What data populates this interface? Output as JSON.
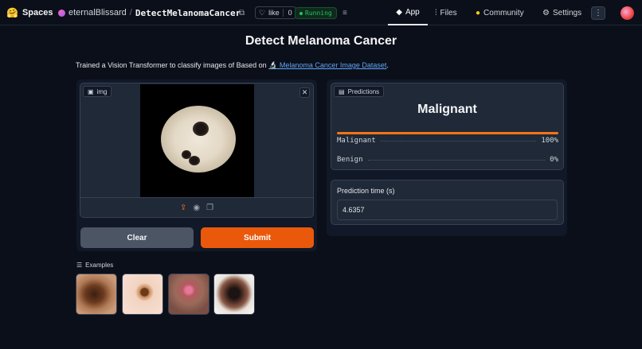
{
  "header": {
    "brand": "Spaces",
    "owner": "eternalBlissard",
    "slash": "/",
    "repo": "DetectMelanomaCancer",
    "like_label": "like",
    "like_count": "0",
    "status": "Running",
    "nav": {
      "app": "App",
      "files": "Files",
      "community": "Community",
      "settings": "Settings"
    }
  },
  "main": {
    "title": "Detect Melanoma Cancer",
    "description_prefix": "Trained a Vision Transformer to classify images of Based on",
    "dataset_link": "🔬 Melanoma Cancer Image Dataset",
    "description_suffix": "."
  },
  "input": {
    "label": "img",
    "close_glyph": "✕"
  },
  "buttons": {
    "clear": "Clear",
    "submit": "Submit"
  },
  "examples": {
    "label": "Examples",
    "count": 4
  },
  "predictions": {
    "label": "Predictions",
    "top": "Malignant",
    "top_confidence": 1.0,
    "rows": [
      {
        "name": "Malignant",
        "value": "100%",
        "fraction": 1.0
      },
      {
        "name": "Benign",
        "value": "0%",
        "fraction": 0.0
      }
    ]
  },
  "timing": {
    "label": "Prediction time (s)",
    "value": "4.6357"
  },
  "colors": {
    "accent": "#f97316",
    "submit": "#ea580c",
    "running": "#22c55e",
    "link": "#60a5fa"
  }
}
